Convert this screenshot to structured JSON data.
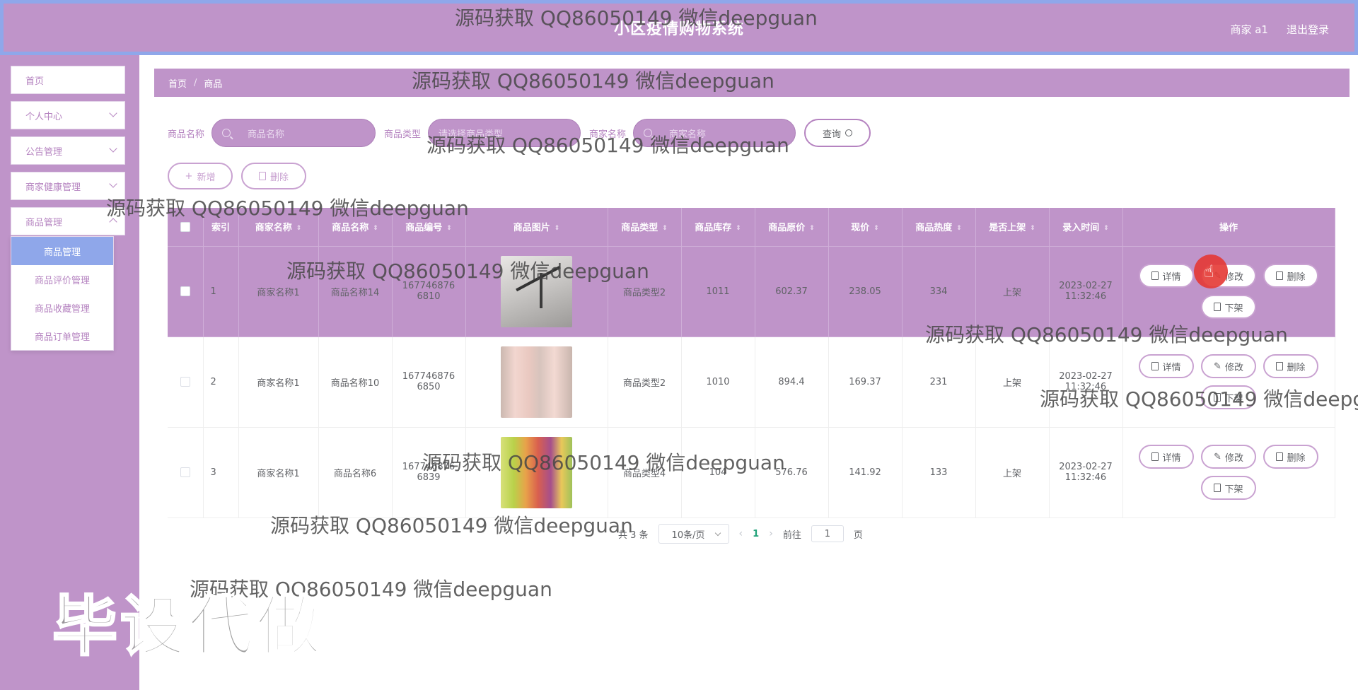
{
  "header": {
    "title": "小区疫情购物系统",
    "user": "商家 a1",
    "logout": "退出登录"
  },
  "sidebar": {
    "items": [
      {
        "label": "首页"
      },
      {
        "label": "个人中心"
      },
      {
        "label": "公告管理"
      },
      {
        "label": "商家健康管理"
      },
      {
        "label": "商品管理"
      }
    ],
    "submenu": [
      {
        "label": "商品管理",
        "active": true
      },
      {
        "label": "商品评价管理"
      },
      {
        "label": "商品收藏管理"
      },
      {
        "label": "商品订单管理"
      }
    ]
  },
  "breadcrumb": {
    "home": "首页",
    "sep": "/",
    "current": "商品"
  },
  "search": {
    "name_label": "商品名称",
    "name_placeholder": "商品名称",
    "type_label": "商品类型",
    "type_placeholder": "请选择商品类型",
    "merchant_label": "商家名称",
    "merchant_placeholder": "商家名称",
    "query": "查询"
  },
  "actions": {
    "add": "新增",
    "delete": "删除"
  },
  "table": {
    "headers": [
      "索引",
      "商家名称",
      "商品名称",
      "商品编号",
      "商品图片",
      "商品类型",
      "商品库存",
      "商品原价",
      "现价",
      "商品热度",
      "是否上架",
      "录入时间",
      "操作"
    ],
    "rows": [
      {
        "index": "1",
        "merchant": "商家名称1",
        "name": "商品名称14",
        "code_a": "167746876",
        "code_b": "6810",
        "type": "商品类型2",
        "stock": "1011",
        "orig": "602.37",
        "price": "238.05",
        "heat": "334",
        "status": "上架",
        "date": "2023-02-27",
        "time": "11:32:46"
      },
      {
        "index": "2",
        "merchant": "商家名称1",
        "name": "商品名称10",
        "code_a": "167746876",
        "code_b": "6850",
        "type": "商品类型2",
        "stock": "1010",
        "orig": "894.4",
        "price": "169.37",
        "heat": "231",
        "status": "上架",
        "date": "2023-02-27",
        "time": "11:32:46"
      },
      {
        "index": "3",
        "merchant": "商家名称1",
        "name": "商品名称6",
        "code_a": "167746876",
        "code_b": "6839",
        "type": "商品类型4",
        "stock": "104",
        "orig": "576.76",
        "price": "141.92",
        "heat": "133",
        "status": "上架",
        "date": "2023-02-27",
        "time": "11:32:46"
      }
    ],
    "op_detail": "详情",
    "op_edit": "修改",
    "op_delete": "删除",
    "op_off": "下架"
  },
  "pagination": {
    "total": "共 3 条",
    "size": "10条/页",
    "page": "1",
    "goto": "前往",
    "goto_value": "1",
    "page_unit": "页"
  },
  "watermark": {
    "text": "源码获取 QQ86050149 微信deepguan",
    "big": "毕设代做"
  },
  "colors": {
    "theme": "#bf94c9",
    "accent": "#8fa7ea",
    "page_active": "#21a279"
  }
}
